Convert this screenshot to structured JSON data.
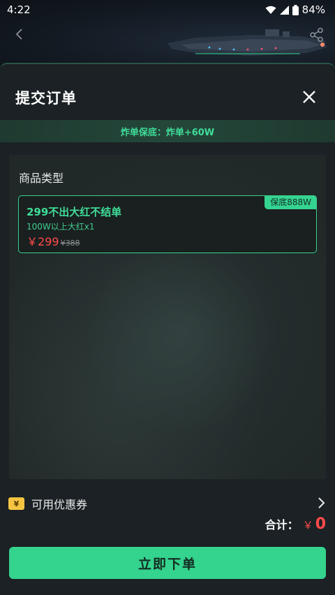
{
  "status_bar": {
    "time": "4:22",
    "battery": "84%",
    "icons": [
      "wifi-icon",
      "signal-icon",
      "battery-icon"
    ]
  },
  "header": {
    "back_icon": "chevron-left-icon",
    "share_icon": "share-icon"
  },
  "sheet": {
    "title": "提交订单",
    "close_icon": "close-icon",
    "promo_text": "炸单保底：炸单+60W",
    "section_label": "商品类型",
    "product": {
      "badge": "保底888W",
      "name": "299不出大红不结单",
      "desc": "100W以上大红x1",
      "price_currency": "￥",
      "price_now": "299",
      "price_orig_prefix": "¥",
      "price_orig": "388"
    }
  },
  "footer": {
    "coupon_label": "可用优惠券",
    "coupon_icon_glyph": "¥",
    "total_label": "合计：",
    "total_currency": "￥",
    "total_value": "0",
    "order_button": "立即下单"
  },
  "colors": {
    "accent": "#34d38e",
    "price": "#ff4a4a",
    "background": "#1b2124",
    "coupon": "#f5c542"
  }
}
